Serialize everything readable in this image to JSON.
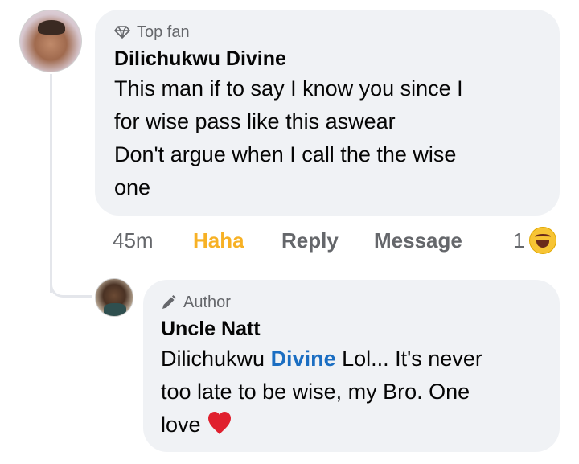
{
  "comment": {
    "badge": "Top fan",
    "author": "Dilichukwu Divine",
    "lines": [
      "This man if to say I know you since I",
      "for wise pass like this aswear",
      "Don't argue when I call the the wise",
      "one"
    ]
  },
  "actions": {
    "time": "45m",
    "reaction_label": "Haha",
    "reply_label": "Reply",
    "message_label": "Message",
    "reaction_count": "1",
    "reaction_icon": "laughing-emoji-icon"
  },
  "reply": {
    "badge": "Author",
    "author": "Uncle Natt",
    "mention_first": "Dilichukwu",
    "mention_second": "Divine",
    "line1_rest": " Lol... It's never",
    "line2": "too late to be wise, my Bro. One",
    "line3": "love",
    "heart_icon": "red-heart-icon"
  },
  "colors": {
    "bubble": "#f0f2f5",
    "haha": "#f7b125",
    "mention": "#1b6ec2",
    "secondary_text": "#65676b"
  }
}
